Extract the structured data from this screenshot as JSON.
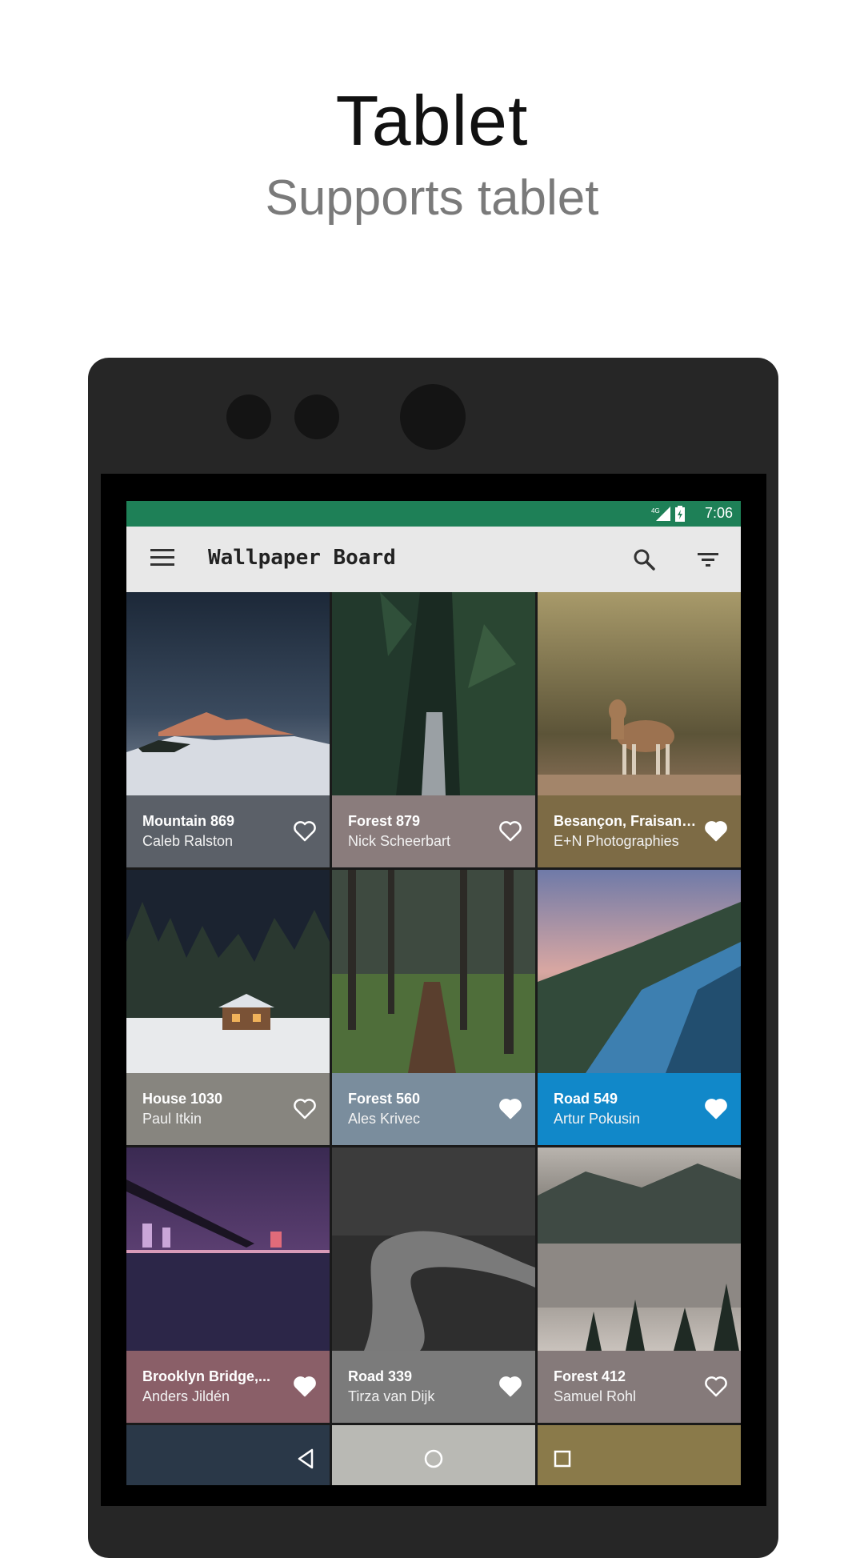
{
  "hero": {
    "title": "Tablet",
    "subtitle": "Supports tablet"
  },
  "status": {
    "network": "4G",
    "time": "7:06"
  },
  "toolbar": {
    "title": "Wallpaper Board",
    "menu_icon": "menu-icon",
    "search_icon": "search-icon",
    "filter_icon": "filter-icon"
  },
  "colors": {
    "status_bar": "#1e8057",
    "toolbar": "#e8e8e8",
    "device": "#262626"
  },
  "wallpapers": [
    {
      "name": "Mountain 869",
      "author": "Caleb Ralston",
      "caption_color": "#5b6068",
      "favorite": false
    },
    {
      "name": "Forest 879",
      "author": "Nick Scheerbart",
      "caption_color": "#8a7c7c",
      "favorite": false
    },
    {
      "name": "Besançon, Fraisans...",
      "author": "E+N Photographies",
      "caption_color": "#7d6b45",
      "favorite": true
    },
    {
      "name": "House 1030",
      "author": "Paul Itkin",
      "caption_color": "#87857f",
      "favorite": false
    },
    {
      "name": "Forest 560",
      "author": "Ales Krivec",
      "caption_color": "#7a8d9d",
      "favorite": true
    },
    {
      "name": "Road 549",
      "author": "Artur Pokusin",
      "caption_color": "#1188c9",
      "favorite": true
    },
    {
      "name": "Brooklyn Bridge,...",
      "author": "Anders Jildén",
      "caption_color": "#8a5f68",
      "favorite": true
    },
    {
      "name": "Road 339",
      "author": "Tirza van Dijk",
      "caption_color": "#7b7b7b",
      "favorite": true
    },
    {
      "name": "Forest 412",
      "author": "Samuel Rohl",
      "caption_color": "#857a7a",
      "favorite": false
    }
  ],
  "navigation": {
    "back_icon": "back-icon",
    "home_icon": "home-icon",
    "recents_icon": "recents-icon"
  }
}
